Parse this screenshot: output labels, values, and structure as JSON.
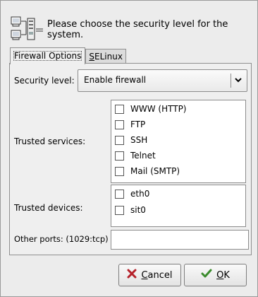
{
  "header": {
    "message": "Please choose the security level for the system.",
    "icon": "network-computers-icon"
  },
  "tabs": [
    {
      "label": "Firewall Options",
      "active": true
    },
    {
      "label": "SELinux",
      "active": false,
      "mnemonic": "S"
    }
  ],
  "security_level": {
    "label": "Security level:",
    "selected": "Enable firewall"
  },
  "trusted_services": {
    "label": "Trusted services:",
    "items": [
      {
        "label": "WWW (HTTP)",
        "checked": false
      },
      {
        "label": "FTP",
        "checked": false
      },
      {
        "label": "SSH",
        "checked": false
      },
      {
        "label": "Telnet",
        "checked": false
      },
      {
        "label": "Mail (SMTP)",
        "checked": false
      }
    ]
  },
  "trusted_devices": {
    "label": "Trusted devices:",
    "items": [
      {
        "label": "eth0",
        "checked": false
      },
      {
        "label": "sit0",
        "checked": false
      }
    ]
  },
  "other_ports": {
    "label": "Other ports:  (1029:tcp)",
    "value": ""
  },
  "buttons": {
    "cancel": {
      "label": "Cancel",
      "mnemonic": "C",
      "icon": "cancel-icon",
      "color": "#b5212a"
    },
    "ok": {
      "label": "OK",
      "mnemonic": "O",
      "icon": "checkmark-icon",
      "color": "#3a8b2c"
    }
  }
}
